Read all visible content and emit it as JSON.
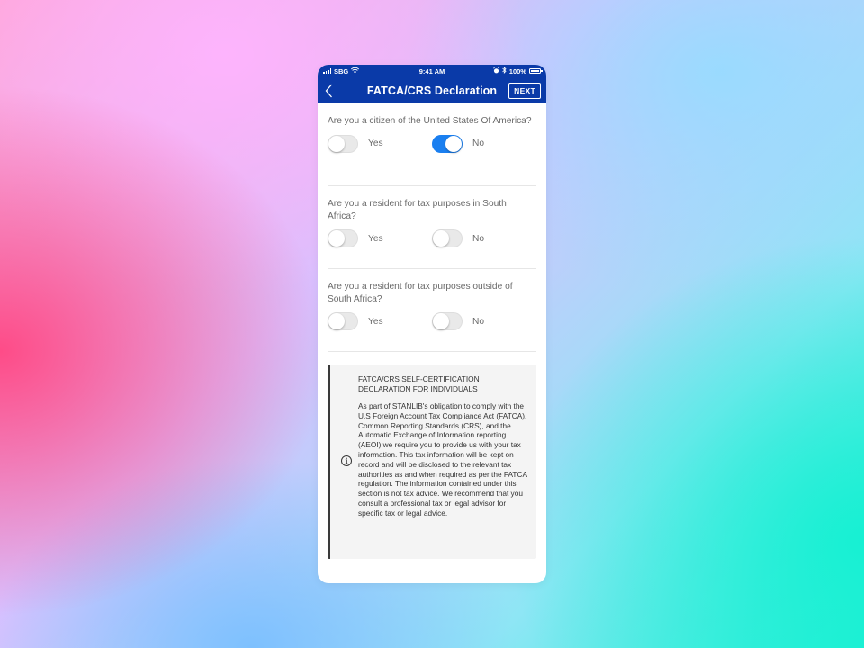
{
  "status_bar": {
    "carrier": "SBG",
    "time": "9:41 AM",
    "battery": "100%",
    "icons": [
      "signal-icon",
      "wifi-icon",
      "alarm-icon",
      "bluetooth-icon",
      "battery-icon"
    ]
  },
  "nav": {
    "title": "FATCA/CRS Declaration",
    "next_label": "NEXT",
    "back_icon": "chevron-left-icon"
  },
  "questions": [
    {
      "text": "Are you a citizen of the United States Of America?",
      "yes_label": "Yes",
      "no_label": "No",
      "selected": "No"
    },
    {
      "text": "Are you a resident for tax purposes in South Africa?",
      "yes_label": "Yes",
      "no_label": "No",
      "selected": null
    },
    {
      "text": "Are you a resident for tax purposes outside of South Africa?",
      "yes_label": "Yes",
      "no_label": "No",
      "selected": null
    }
  ],
  "info": {
    "icon": "info-icon",
    "title": "FATCA/CRS SELF-CERTIFICATION DECLARATION FOR INDIVIDUALS",
    "body": "As part of STANLIB's obligation to comply with the U.S Foreign Account Tax Compliance Act (FATCA), Common Reporting Standards (CRS), and the Automatic Exchange of Information reporting (AEOI) we require you to provide us with your tax information. This tax information will be kept on record and will be disclosed to the relevant tax authorities as and when required as per the FATCA regulation. The information contained under this section is not tax advice. We recommend that you consult a professional tax or legal advisor for specific tax or legal advice."
  },
  "colors": {
    "header_bg": "#0a3aa8",
    "toggle_on": "#1a7ff0",
    "info_border": "#3a3a3a"
  }
}
